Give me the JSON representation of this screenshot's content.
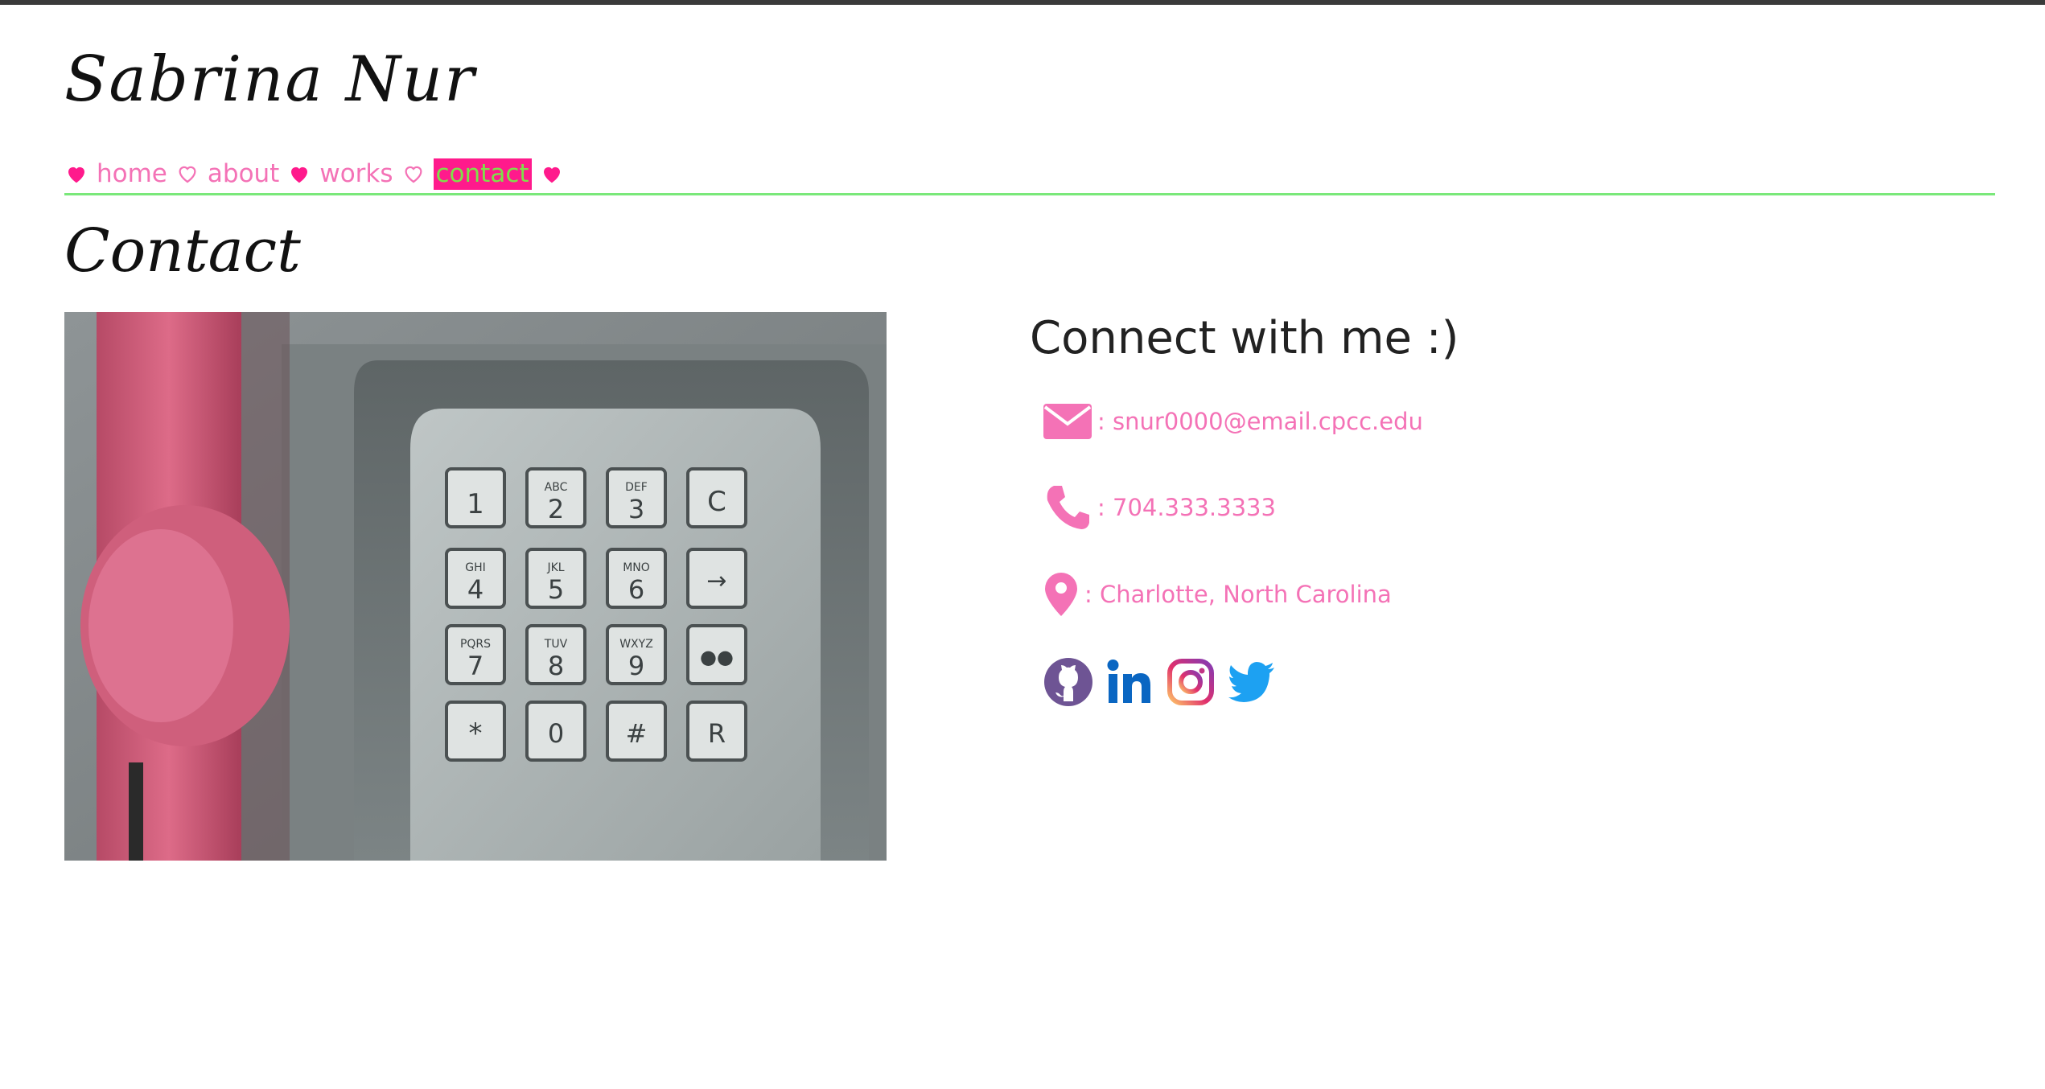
{
  "site": {
    "title": "Sabrina Nur"
  },
  "nav": {
    "items": [
      {
        "label": "home"
      },
      {
        "label": "about"
      },
      {
        "label": "works"
      },
      {
        "label": "contact",
        "active": true
      }
    ]
  },
  "page": {
    "title": "Contact"
  },
  "contact": {
    "heading": "Connect with me :)",
    "email": ": snur0000@email.cpcc.edu",
    "phone": ": 704.333.3333",
    "location": ": Charlotte, North Carolina"
  },
  "social": {
    "links": [
      {
        "icon": "github-icon"
      },
      {
        "icon": "linkedin-icon"
      },
      {
        "icon": "instagram-icon"
      },
      {
        "icon": "twitter-icon"
      }
    ]
  },
  "colors": {
    "accent_pink": "#ff1a8c",
    "link_pink": "#f472b6",
    "rule_green": "#7ae87a",
    "active_text_green": "#7ee04a"
  }
}
